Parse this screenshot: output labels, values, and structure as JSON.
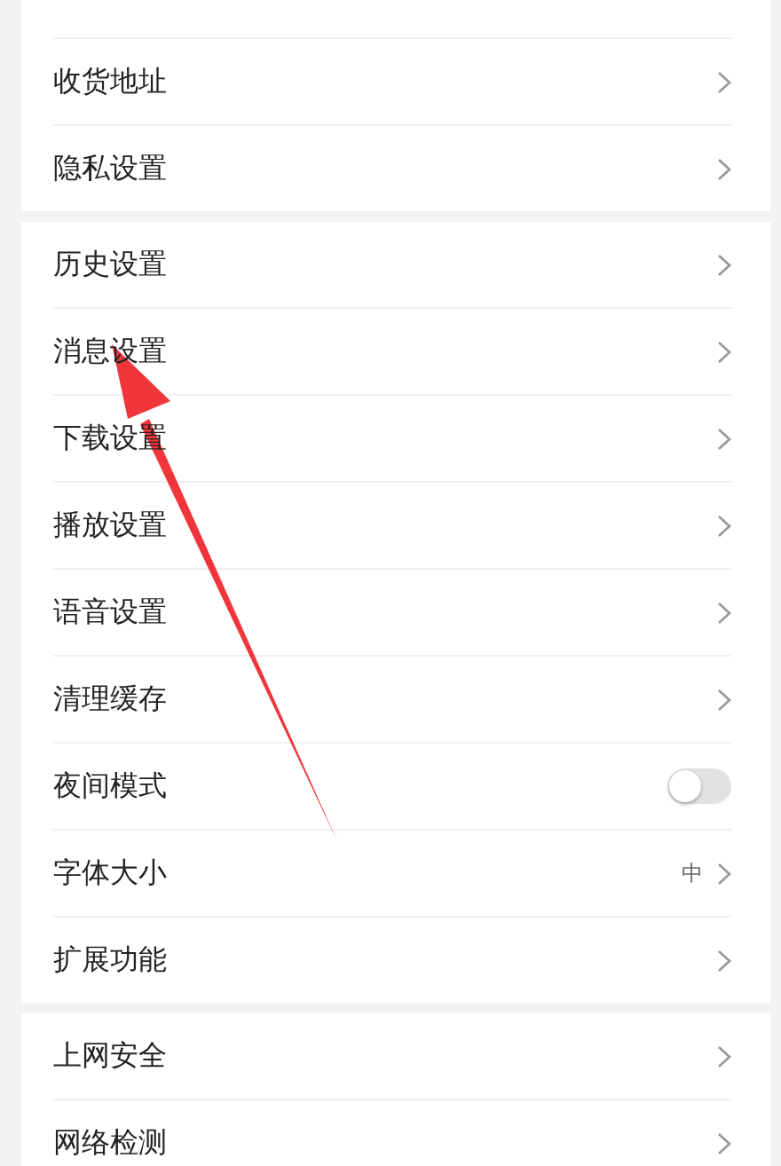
{
  "groups": [
    {
      "rows": [
        {
          "kind": "cut"
        },
        {
          "kind": "link",
          "label": "收货地址"
        },
        {
          "kind": "link",
          "label": "隐私设置"
        }
      ]
    },
    {
      "rows": [
        {
          "kind": "link",
          "label": "历史设置"
        },
        {
          "kind": "link",
          "label": "消息设置"
        },
        {
          "kind": "link",
          "label": "下载设置"
        },
        {
          "kind": "link",
          "label": "播放设置"
        },
        {
          "kind": "link",
          "label": "语音设置"
        },
        {
          "kind": "link",
          "label": "清理缓存"
        },
        {
          "kind": "toggle",
          "label": "夜间模式",
          "on": false
        },
        {
          "kind": "value",
          "label": "字体大小",
          "value": "中"
        },
        {
          "kind": "link",
          "label": "扩展功能"
        }
      ]
    },
    {
      "rows": [
        {
          "kind": "link",
          "label": "上网安全"
        },
        {
          "kind": "link",
          "label": "网络检测"
        }
      ]
    }
  ],
  "annotations": [
    {
      "kind": "arrow",
      "color": "#f0353b"
    }
  ]
}
